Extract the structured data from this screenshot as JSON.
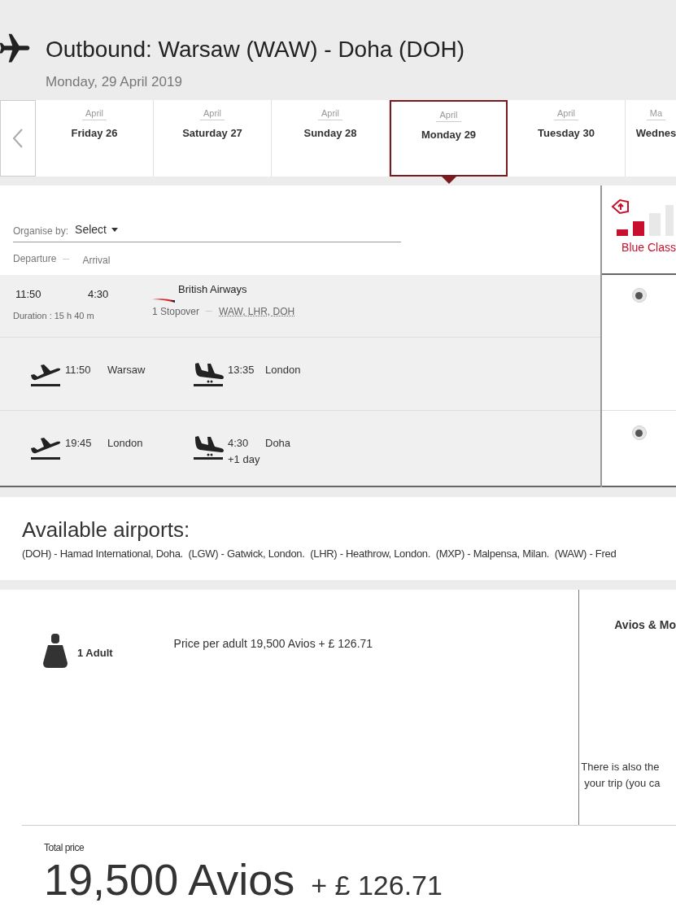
{
  "header": {
    "title": "Outbound: Warsaw (WAW) - Doha (DOH)",
    "date": "Monday, 29 April 2019"
  },
  "dates": [
    {
      "month": "April",
      "day": "Friday 26",
      "selected": false
    },
    {
      "month": "April",
      "day": "Saturday 27",
      "selected": false
    },
    {
      "month": "April",
      "day": "Sunday 28",
      "selected": false
    },
    {
      "month": "April",
      "day": "Monday 29",
      "selected": true
    },
    {
      "month": "April",
      "day": "Tuesday 30",
      "selected": false
    },
    {
      "month": "Ma",
      "day": "Wednes",
      "selected": false
    }
  ],
  "organise": {
    "label": "Organise by:",
    "value": "Select"
  },
  "columns": [
    "Departure",
    "Arrival"
  ],
  "fare_class": {
    "name": "Blue Class"
  },
  "flight": {
    "departure": "11:50",
    "arrival": "4:30",
    "airline": "British Airways",
    "duration": "Duration : 15 h 40 m",
    "stops": "1 Stopover",
    "route": "WAW, LHR, DOH",
    "selected": true
  },
  "segments": [
    {
      "dep_time": "11:50",
      "dep_city": "Warsaw",
      "arr_time": "13:35",
      "arr_city": "London"
    },
    {
      "dep_time": "19:45",
      "dep_city": "London",
      "arr_time": "4:30",
      "arr_extra": "+1 day",
      "arr_city": "Doha",
      "radio_selected": true
    }
  ],
  "airports": {
    "title": "Available airports:",
    "text": "(DOH) - Hamad International, Doha.  (LGW) - Gatwick, London.  (LHR) - Heathrow, London.  (MXP) - Malpensa, Milan.  (WAW) - Fred"
  },
  "passengers": {
    "label": "1 Adult",
    "price": "Price per adult 19,500 Avios + £ 126.71"
  },
  "payment": {
    "title": "Avios & Mo",
    "note_1": "There is also the",
    "note_2": "your trip (you ca"
  },
  "total": {
    "label": "Total price",
    "avios": "19,500 Avios",
    "cash": "+ £ 126.71"
  }
}
